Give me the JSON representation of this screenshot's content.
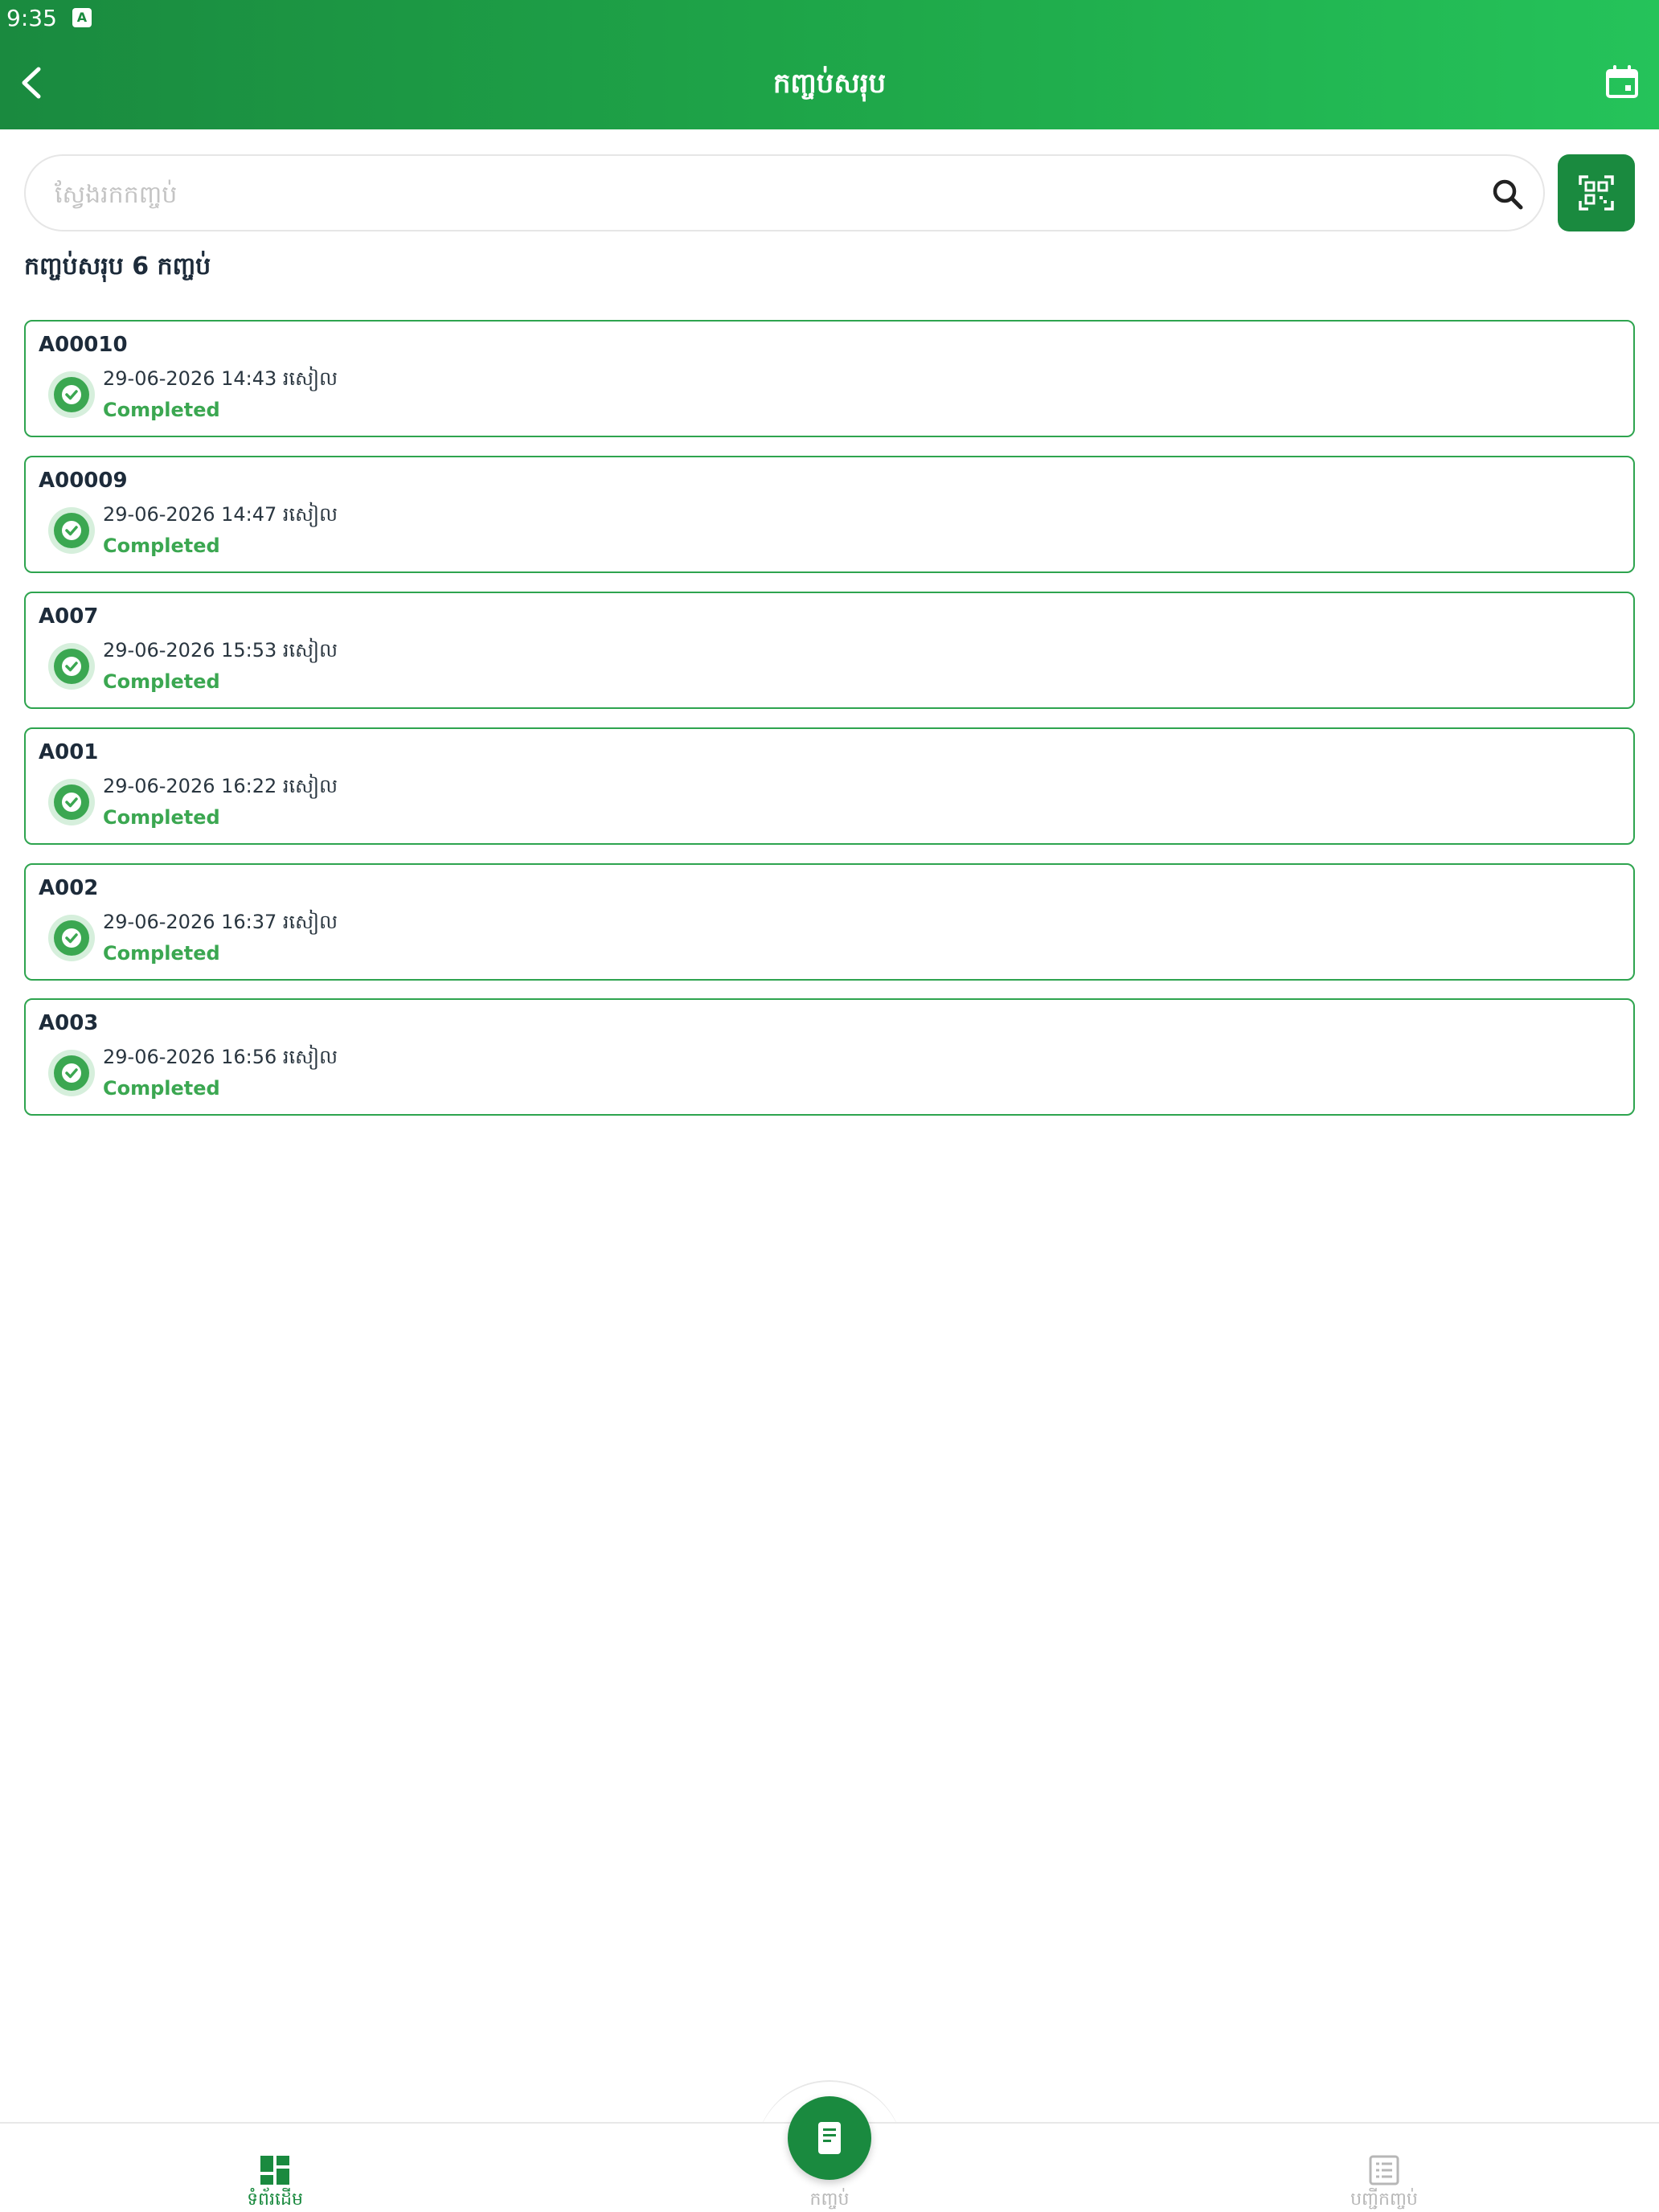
{
  "status_bar": {
    "time": "9:35",
    "badge": "A"
  },
  "header": {
    "title": "កញ្ចប់សរុប"
  },
  "search": {
    "placeholder": "ស្វែងរកកញ្ចប់"
  },
  "summary_text": "កញ្ចប់សរុប 6 កញ្ចប់",
  "orders": [
    {
      "id": "A00010",
      "datetime": "29-06-2026 14:43 រសៀល",
      "status": "Completed"
    },
    {
      "id": "A00009",
      "datetime": "29-06-2026 14:47 រសៀល",
      "status": "Completed"
    },
    {
      "id": "A007",
      "datetime": "29-06-2026 15:53 រសៀល",
      "status": "Completed"
    },
    {
      "id": "A001",
      "datetime": "29-06-2026 16:22 រសៀល",
      "status": "Completed"
    },
    {
      "id": "A002",
      "datetime": "29-06-2026 16:37 រសៀល",
      "status": "Completed"
    },
    {
      "id": "A003",
      "datetime": "29-06-2026 16:56 រសៀល",
      "status": "Completed"
    }
  ],
  "bottom_nav": {
    "home": "ទំព័រដើម",
    "center": "កញ្ចប់",
    "list": "បញ្ជីកញ្ចប់"
  },
  "colors": {
    "primary": "#1a8a3f",
    "status_completed": "#3ba751",
    "card_border": "#2ea44f"
  },
  "icons": [
    "back-arrow-icon",
    "calendar-icon",
    "search-icon",
    "qr-scan-icon",
    "check-circle-icon",
    "dashboard-icon",
    "package-icon",
    "list-icon"
  ]
}
